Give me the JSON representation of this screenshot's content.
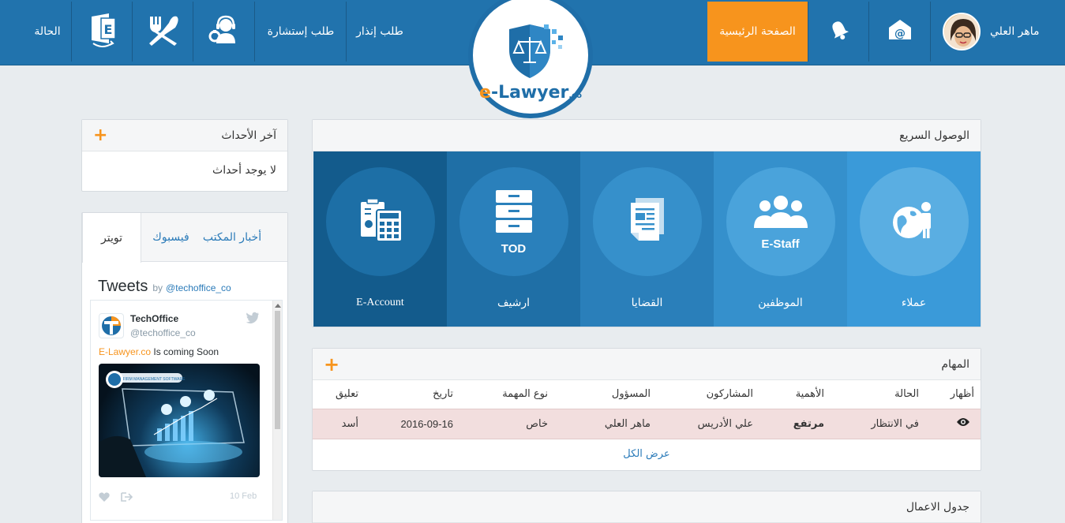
{
  "user": {
    "name": "ماهر العلي"
  },
  "nav": {
    "home": "الصفحة الرئيسية",
    "warning_request": "طلب إنذار",
    "consult_request": "طلب إستشارة",
    "status": "الحالة"
  },
  "logo": {
    "brand_e": "e",
    "brand_rest": "-Lawyer",
    "tld": ".co"
  },
  "quick_access": {
    "title": "الوصول السريع",
    "tiles": [
      {
        "label": "عملاء",
        "sub": "",
        "icon": "clients-globe-icon",
        "color": "#3a9ad9"
      },
      {
        "label": "الموظفين",
        "sub": "E-Staff",
        "icon": "staff-group-icon",
        "color": "#3590cc"
      },
      {
        "label": "القضايا",
        "sub": "",
        "icon": "cases-documents-icon",
        "color": "#2a7fba"
      },
      {
        "label": "ارشيف",
        "sub": "TOD",
        "icon": "archive-cabinet-icon",
        "color": "#1f6fa6"
      },
      {
        "label": "E-Account",
        "sub": "",
        "icon": "accounting-calculator-icon",
        "color": "#135b8c"
      }
    ]
  },
  "tasks": {
    "title": "المهام",
    "columns": [
      "أظهار",
      "الحالة",
      "الأهمية",
      "المشاركون",
      "المسؤول",
      "نوع المهمة",
      "تاريخ",
      "تعليق"
    ],
    "rows": [
      {
        "status": "في الانتظار",
        "priority": "مرتفع",
        "participants": "علي الأدريس",
        "owner": "ماهر العلي",
        "type": "خاص",
        "date": "2016-09-16",
        "comment": "أسد"
      }
    ],
    "view_all": "عرض الكل"
  },
  "schedule": {
    "title": "جدول الاعمال"
  },
  "events": {
    "title": "آخر الأحداث",
    "empty": "لا يوجد أحداث"
  },
  "social": {
    "tabs": [
      "أخبار المكتب",
      "فيسبوك",
      "تويتر"
    ],
    "active_tab": "تويتر",
    "widget_title": "Tweets",
    "widget_by": "by",
    "widget_handle": "@techoffice_co",
    "tweet": {
      "author": "TechOffice",
      "handle": "@techoffice_co",
      "link_text": "E-Lawyer.co",
      "text": " Is coming Soon",
      "date": "10 Feb",
      "image_caption": "LAW FIRM MANAGEMENT SOFTWARE"
    }
  },
  "colors": {
    "topbar": "#2173ad",
    "accent": "#f7941d",
    "danger": "#d9262c",
    "link": "#2b7bb9"
  }
}
